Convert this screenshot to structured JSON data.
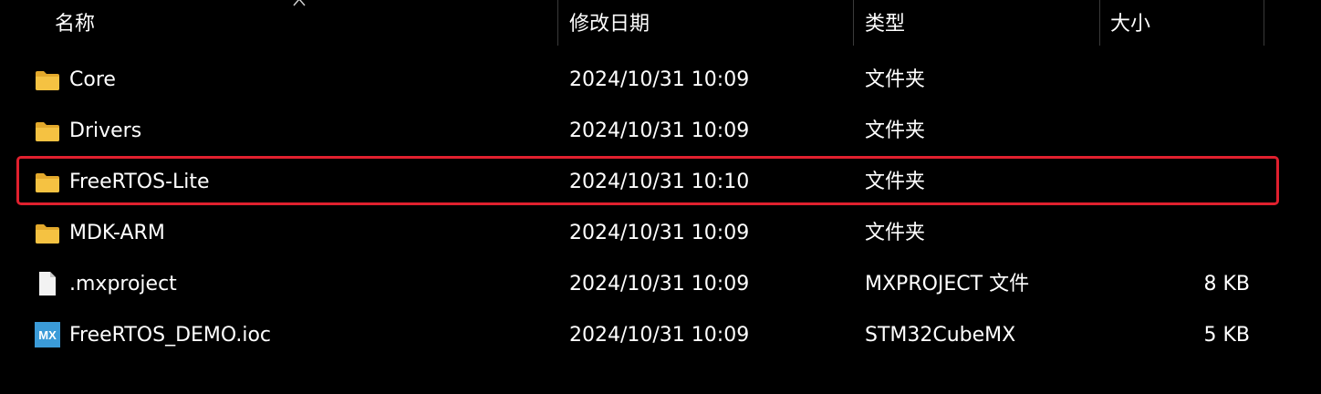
{
  "columns": {
    "name": "名称",
    "date": "修改日期",
    "type": "类型",
    "size": "大小"
  },
  "sort": {
    "column": "name",
    "direction": "ascending",
    "icon": "sort-up-icon"
  },
  "files": [
    {
      "name": "Core",
      "date": "2024/10/31 10:09",
      "type": "文件夹",
      "size": "",
      "icon": "folder-icon"
    },
    {
      "name": "Drivers",
      "date": "2024/10/31 10:09",
      "type": "文件夹",
      "size": "",
      "icon": "folder-icon"
    },
    {
      "name": "FreeRTOS-Lite",
      "date": "2024/10/31 10:10",
      "type": "文件夹",
      "size": "",
      "icon": "folder-icon",
      "highlighted": true
    },
    {
      "name": "MDK-ARM",
      "date": "2024/10/31 10:09",
      "type": "文件夹",
      "size": "",
      "icon": "folder-icon"
    },
    {
      "name": ".mxproject",
      "date": "2024/10/31 10:09",
      "type": "MXPROJECT 文件",
      "size": "8 KB",
      "icon": "file-icon"
    },
    {
      "name": "FreeRTOS_DEMO.ioc",
      "date": "2024/10/31 10:09",
      "type": "STM32CubeMX",
      "size": "5 KB",
      "icon": "stm32cubemx-icon"
    }
  ],
  "colors": {
    "background": "#000000",
    "text": "#ffffff",
    "folder": "#f5c242",
    "highlight_border": "#e0202e",
    "mx_badge": "#3b9bd8"
  },
  "mx_badge_text": "MX"
}
